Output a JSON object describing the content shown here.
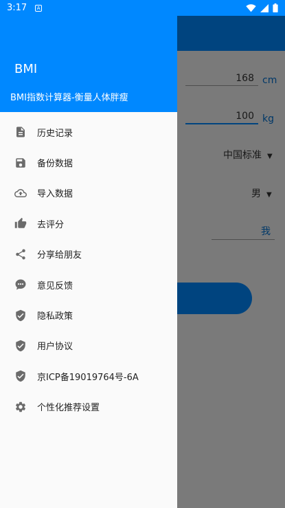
{
  "status_bar": {
    "time": "3:17",
    "notification_icon": "A"
  },
  "background": {
    "height_value": "168",
    "height_unit": "cm",
    "weight_value": "100",
    "weight_unit": "kg",
    "standard": "中国标准",
    "gender": "男",
    "name_value": "我"
  },
  "drawer": {
    "title": "BMI",
    "subtitle": "BMI指数计算器-衡量人体胖瘦",
    "items": [
      {
        "label": "历史记录",
        "icon": "document-icon"
      },
      {
        "label": "备份数据",
        "icon": "save-icon"
      },
      {
        "label": "导入数据",
        "icon": "cloud-upload-icon"
      },
      {
        "label": "去评分",
        "icon": "thumb-up-icon"
      },
      {
        "label": "分享给朋友",
        "icon": "share-icon"
      },
      {
        "label": "意见反馈",
        "icon": "feedback-icon"
      },
      {
        "label": "隐私政策",
        "icon": "shield-check-icon"
      },
      {
        "label": "用户协议",
        "icon": "shield-check-icon"
      },
      {
        "label": "京ICP备19019764号-6A",
        "icon": "shield-check-icon"
      },
      {
        "label": "个性化推荐设置",
        "icon": "gear-icon"
      }
    ]
  },
  "colors": {
    "primary": "#0088ff",
    "icon": "#6b6b6b"
  }
}
